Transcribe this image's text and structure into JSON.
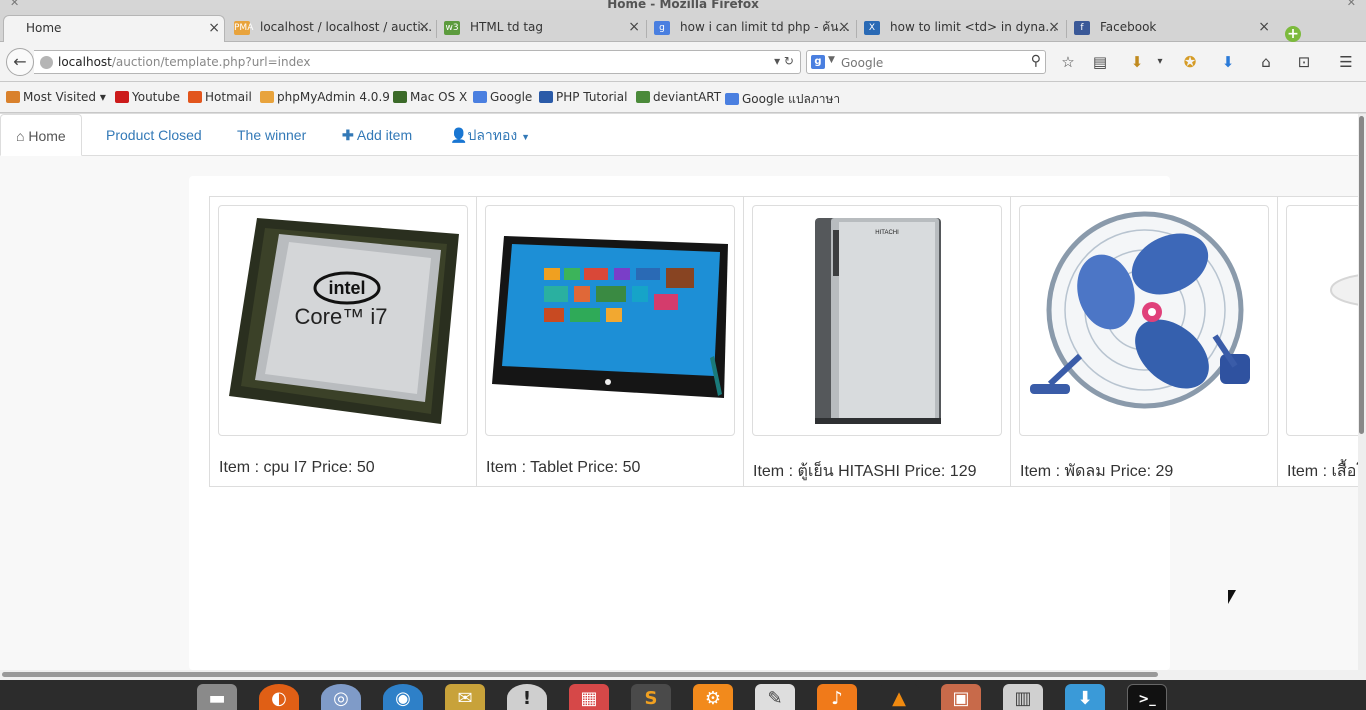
{
  "window": {
    "title": "Home - Mozilla Firefox"
  },
  "tabs": [
    {
      "label": "Home",
      "active": true
    },
    {
      "label": "localhost / localhost / aucti...",
      "favicon": "pma-icon",
      "color": "#e8a33c"
    },
    {
      "label": "HTML td tag",
      "favicon": "w3-icon",
      "color": "#5c9b3d"
    },
    {
      "label": "how i can limit td php - ค้น...",
      "favicon": "google-icon",
      "color": "#4a7fe0"
    },
    {
      "label": "how to limit <td> in dyna...",
      "favicon": "x-site-icon",
      "color": "#2a6ab5"
    },
    {
      "label": "Facebook",
      "favicon": "facebook-icon",
      "color": "#3b5998"
    }
  ],
  "urlbar": {
    "host": "localhost",
    "path": "/auction/template.php?url=index"
  },
  "search": {
    "engine_letter": "g",
    "placeholder": "Google"
  },
  "bookmarks": [
    {
      "label": "Most Visited ▾",
      "color": "#d9812c"
    },
    {
      "label": "Youtube",
      "color": "#cc1b1b"
    },
    {
      "label": "Hotmail",
      "color": "#e2551c"
    },
    {
      "label": "phpMyAdmin 4.0.9",
      "color": "#e8a33c"
    },
    {
      "label": "Mac OS X",
      "color": "#3b6a28"
    },
    {
      "label": "Google",
      "color": "#4a7fe0"
    },
    {
      "label": "PHP Tutorial",
      "color": "#2a5aa8"
    },
    {
      "label": "deviantART",
      "color": "#4b8a3a"
    },
    {
      "label": "Google แปลภาษา",
      "color": "#4a7fe0"
    }
  ],
  "site_nav": {
    "home": "Home",
    "closed": "Product Closed",
    "winner": "The winner",
    "add": "Add item",
    "user": "ปลาทอง"
  },
  "products": [
    {
      "caption": "Item : cpu I7 Price: 50"
    },
    {
      "caption": "Item : Tablet Price: 50"
    },
    {
      "caption": "Item : ตู้เย็น HITASHI Price: 129"
    },
    {
      "caption": "Item : พัดลม Price: 29"
    },
    {
      "caption": "Item : เสื้อโ"
    }
  ],
  "colors": {
    "link": "#3379b7",
    "dock": "#2c2c2c"
  }
}
